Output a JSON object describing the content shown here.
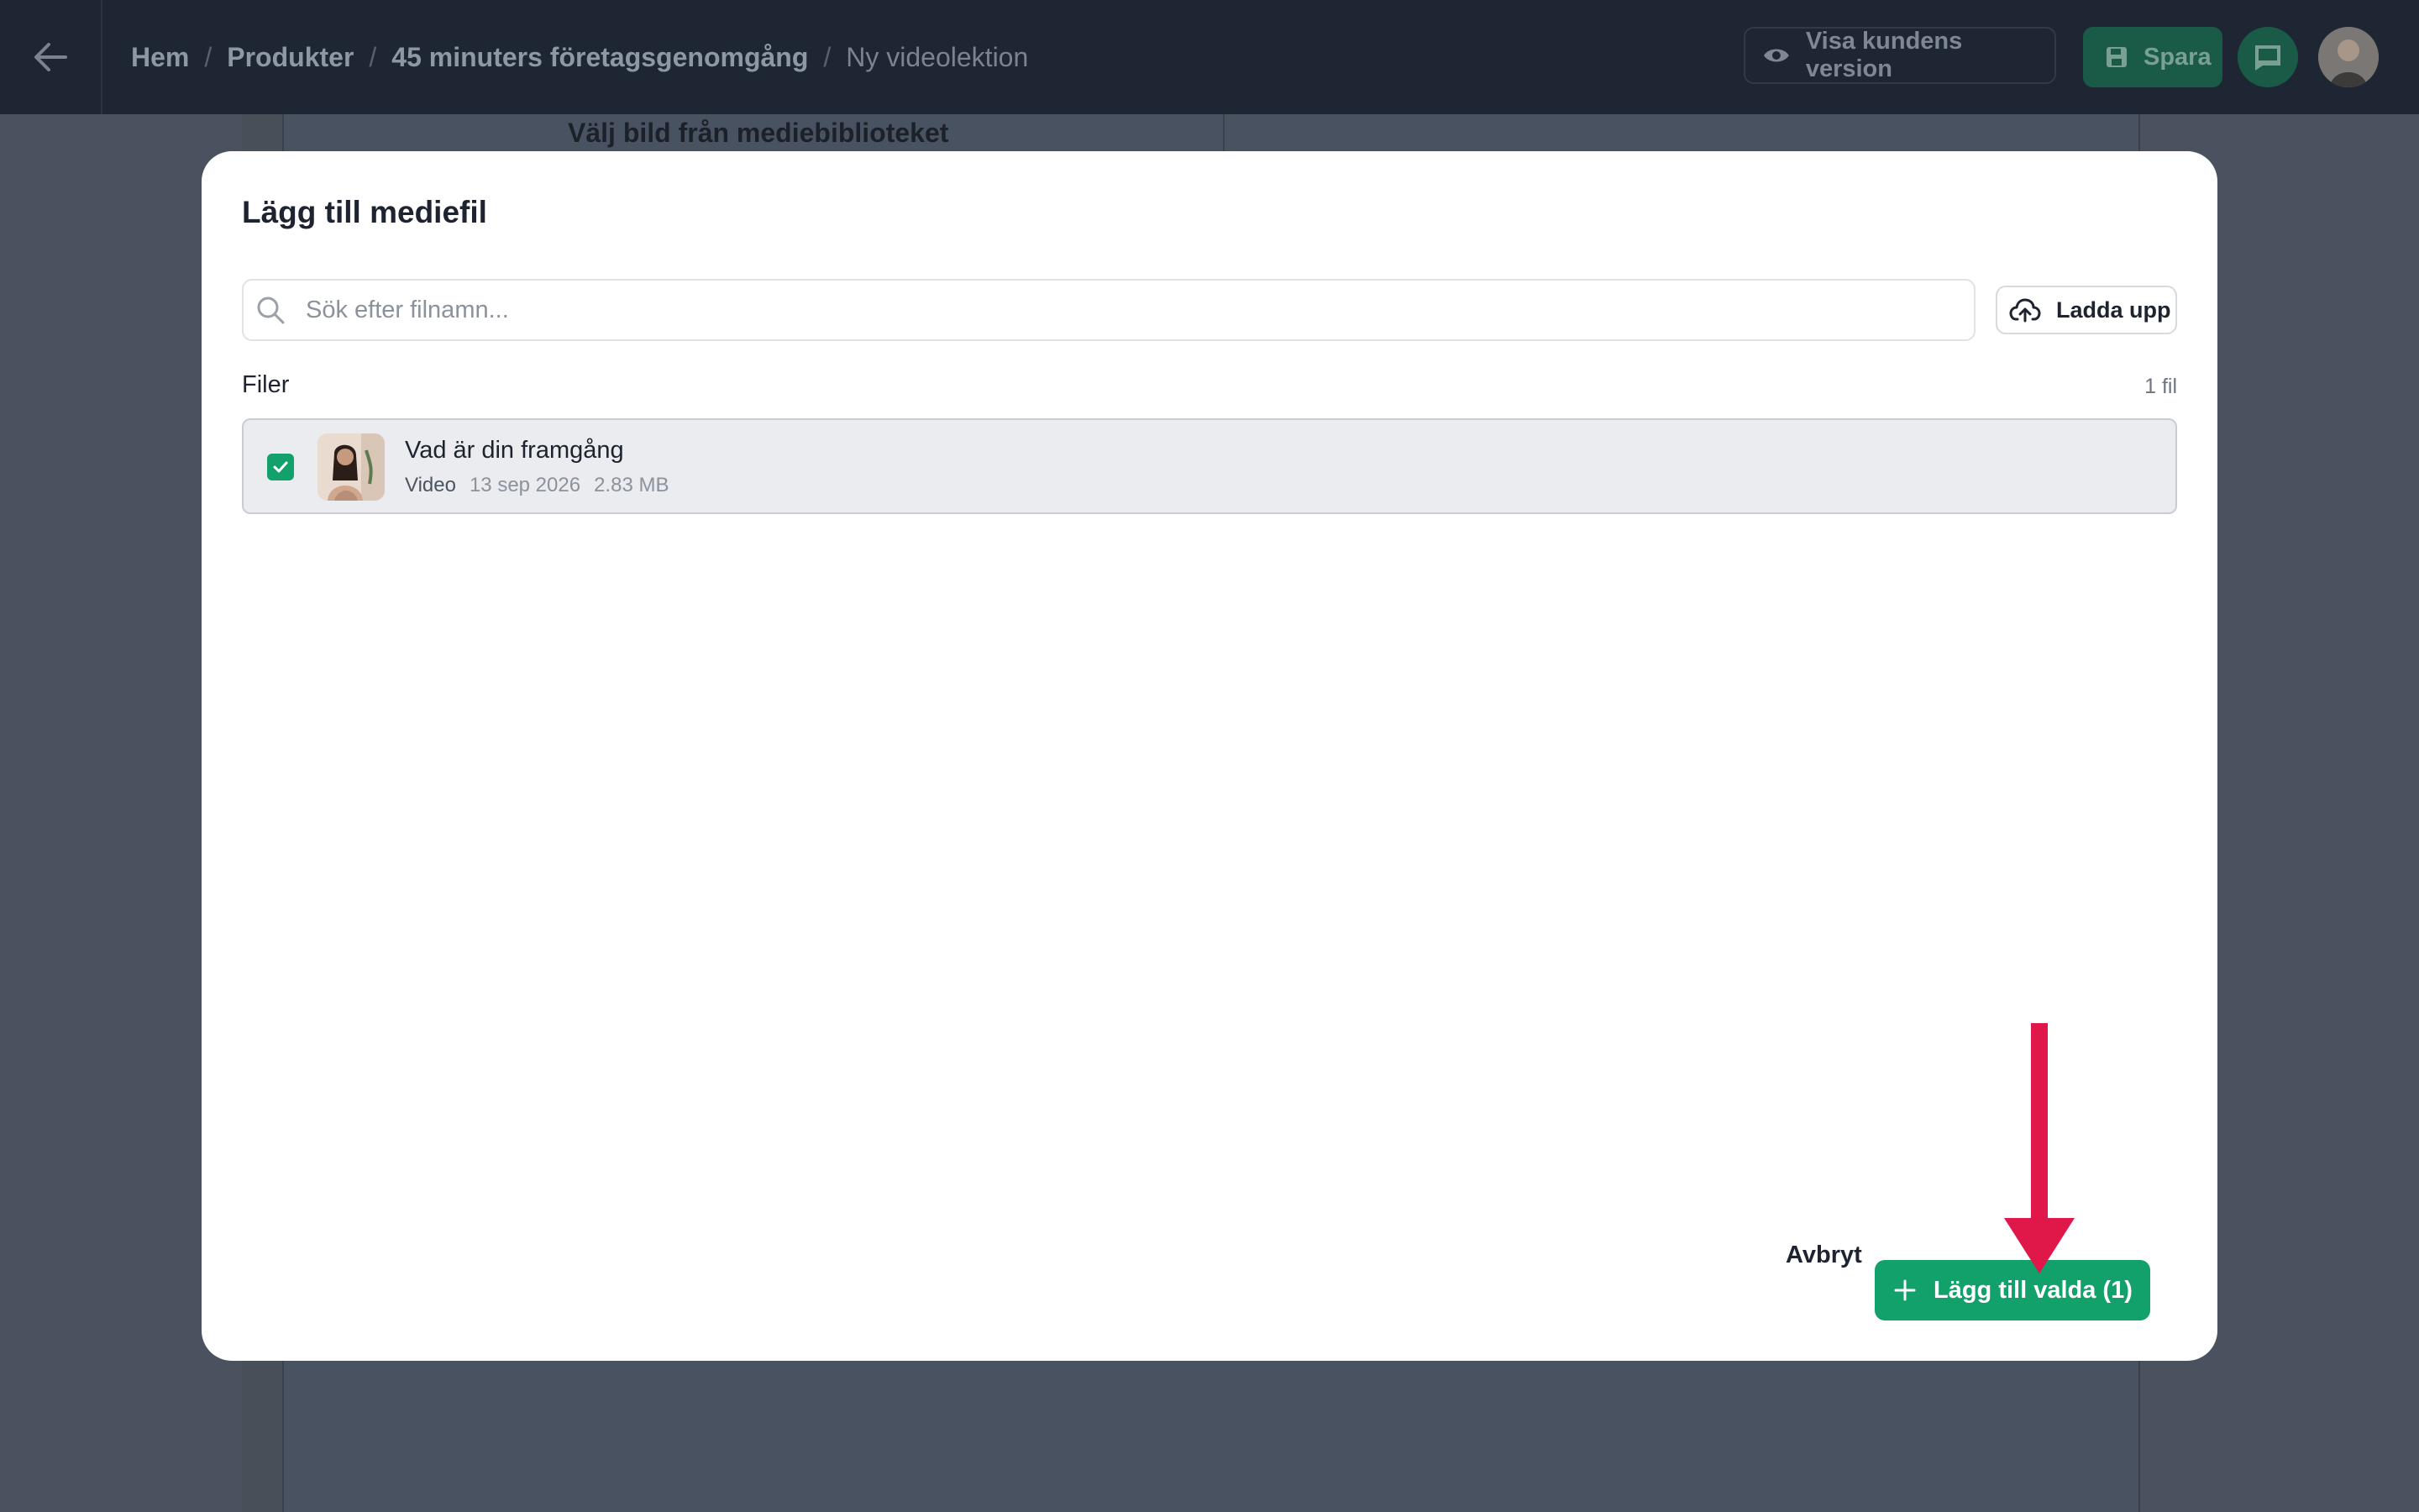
{
  "topbar": {
    "breadcrumb": [
      "Hem",
      "Produkter",
      "45 minuters företagsgenomgång",
      "Ny videolektion"
    ],
    "separator": "/",
    "preview_label": "Visa kundens version",
    "save_label": "Spara"
  },
  "background": {
    "media_library_title": "Välj bild från mediebiblioteket"
  },
  "modal": {
    "title": "Lägg till mediefil",
    "search_placeholder": "Sök efter filnamn...",
    "upload_label": "Ladda upp",
    "files_label": "Filer",
    "files_count": "1 fil",
    "files": [
      {
        "name": "Vad är din framgång",
        "type": "Video",
        "date": "13 sep 2026",
        "size": "2.83 MB",
        "selected": true
      }
    ],
    "cancel_label": "Avbryt",
    "add_selected_label": "Lägg till valda (1)"
  },
  "colors": {
    "accent": "#12a06b",
    "annotation_arrow": "#e0184a",
    "topbar": "#1e2633",
    "overlay": "#4a5260"
  }
}
